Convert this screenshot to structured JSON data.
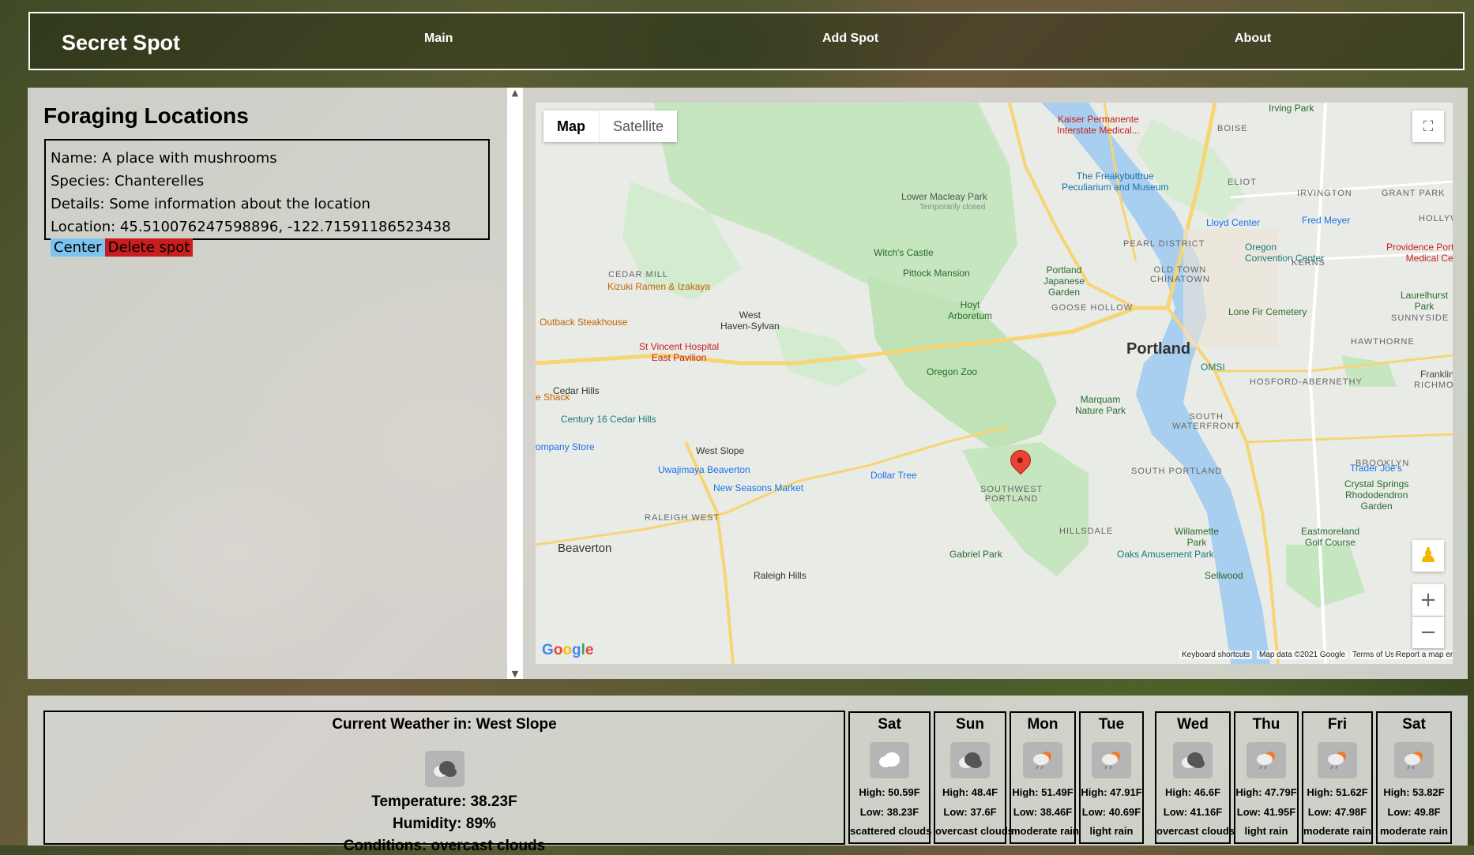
{
  "navbar": {
    "brand": "Secret Spot",
    "links": [
      "Main",
      "Add Spot",
      "About"
    ]
  },
  "locations": {
    "title": "Foraging Locations",
    "cards": [
      {
        "name": "Name: A place with mushrooms",
        "species": "Species: Chanterelles",
        "details": "Details: Some information about the location",
        "location": "Location: 45.510076247598896, -122.71591186523438",
        "center_label": "Center",
        "delete_label": "Delete spot"
      }
    ]
  },
  "map": {
    "type_map": "Map",
    "type_satellite": "Satellite",
    "google": "Google",
    "attribution": [
      "Keyboard shortcuts",
      "Map data ©2021 Google",
      "Terms of Use",
      "Report a map error"
    ],
    "labels": {
      "portland": "Portland",
      "beaverton": "Beaverton",
      "west_haven": "West\nHaven-Sylvan",
      "cedar_hills": "Cedar Hills",
      "west_slope": "West Slope",
      "raleigh_hills": "Raleigh Hills",
      "oregon_zoo": "Oregon Zoo",
      "hoyt": "Hoyt\nArboretum",
      "pittock": "Pittock Mansion",
      "witchs_castle": "Witch's Castle",
      "lower_macleay": "Lower Macleay Park",
      "temporarily_closed": "Temporarily closed",
      "japanese_garden": "Portland\nJapanese\nGarden",
      "freakybuttrue": "The Freakybuttrue\nPeculiarium and Museum",
      "kaiser": "Kaiser Permanente\nInterstate Medical...",
      "lloyd": "Lloyd Center",
      "fred_meyer": "Fred Meyer",
      "convention": "Oregon\nConvention Center",
      "providence": "Providence Portlan\nMedical Cente",
      "laurelhurst": "Laurelhurst\nPark",
      "lone_fir": "Lone Fir Cemetery",
      "omsi": "OMSI",
      "marquam": "Marquam\nNature Park",
      "st_vincent": "St Vincent Hospital\nEast Pavilion",
      "kizuki": "Kizuki Ramen & Izakaya",
      "outback": "Outback Steakhouse",
      "shack": "e Shack",
      "century16": "Century 16 Cedar Hills",
      "company_store": "ompany Store",
      "uwajimaya": "Uwajimaya Beaverton",
      "new_seasons": "New Seasons Market",
      "dollar_tree": "Dollar Tree",
      "trader_joes": "Trader Joe's",
      "crystal_springs": "Crystal Springs\nRhododendron\nGarden",
      "eastmoreland": "Eastmoreland\nGolf Course",
      "willamette_park": "Willamette\nPark",
      "oaks": "Oaks Amusement Park",
      "sellwood": "Sellwood",
      "gabriel": "Gabriel Park",
      "irving_park": "Irving Park",
      "franklin": "Franklin",
      "cedar_mill": "CEDAR MILL",
      "goose_hollow": "GOOSE HOLLOW",
      "pearl": "PEARL DISTRICT",
      "old_town": "OLD TOWN\nCHINATOWN",
      "south_waterfront": "SOUTH\nWATERFRONT",
      "south_portland": "SOUTH PORTLAND",
      "sw_portland": "SOUTHWEST\nPORTLAND",
      "hillsdale": "HILLSDALE",
      "raleigh_west": "RALEIGH WEST",
      "hosford": "HOSFORD-ABERNETHY",
      "brooklyn": "BROOKLYN",
      "hawthorne": "HAWTHORNE",
      "sunnyside": "SUNNYSIDE",
      "kerns": "KERNS",
      "irvington": "IRVINGTON",
      "grant_park": "GRANT PARK",
      "eliot": "ELIOT",
      "boise": "BOISE",
      "hollyw": "HOLLYW",
      "richmond": "RICHMOND"
    }
  },
  "weather": {
    "current": {
      "title": "Current Weather in: West Slope",
      "icon": "cloud-icon",
      "temperature": "Temperature: 38.23F",
      "humidity": "Humidity: 89%",
      "conditions": "Conditions: overcast clouds"
    },
    "forecast": [
      {
        "day": "Sat",
        "icon": "cloud-icon",
        "high": "High: 50.59F",
        "low": "Low: 38.23F",
        "cond": "scattered clouds"
      },
      {
        "day": "Sun",
        "icon": "dark-cloud-icon",
        "high": "High: 48.4F",
        "low": "Low: 37.6F",
        "cond": "overcast clouds"
      },
      {
        "day": "Mon",
        "icon": "rain-icon",
        "high": "High: 51.49F",
        "low": "Low: 38.46F",
        "cond": "moderate rain"
      },
      {
        "day": "Tue",
        "icon": "rain-icon",
        "high": "High: 47.91F",
        "low": "Low: 40.69F",
        "cond": "light rain"
      },
      {
        "day": "Wed",
        "icon": "dark-cloud-icon",
        "high": "High: 46.6F",
        "low": "Low: 41.16F",
        "cond": "overcast clouds"
      },
      {
        "day": "Thu",
        "icon": "rain-icon",
        "high": "High: 47.79F",
        "low": "Low: 41.95F",
        "cond": "light rain"
      },
      {
        "day": "Fri",
        "icon": "rain-icon",
        "high": "High: 51.62F",
        "low": "Low: 47.98F",
        "cond": "moderate rain"
      },
      {
        "day": "Sat",
        "icon": "rain-icon",
        "high": "High: 53.82F",
        "low": "Low: 49.8F",
        "cond": "moderate rain"
      }
    ]
  }
}
